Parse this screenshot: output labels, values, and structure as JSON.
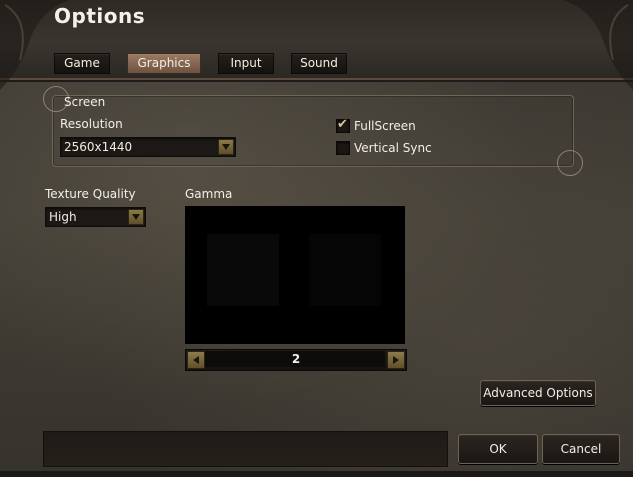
{
  "window": {
    "title": "Options"
  },
  "tabs": [
    {
      "label": "Game",
      "active": false
    },
    {
      "label": "Graphics",
      "active": true
    },
    {
      "label": "Input",
      "active": false
    },
    {
      "label": "Sound",
      "active": false
    }
  ],
  "screen": {
    "group_label": "Screen",
    "resolution_label": "Resolution",
    "resolution_value": "2560x1440",
    "fullscreen": {
      "label": "FullScreen",
      "checked": true
    },
    "vertical_sync": {
      "label": "Vertical Sync",
      "checked": false
    }
  },
  "texture_quality": {
    "label": "Texture Quality",
    "value": "High"
  },
  "gamma": {
    "label": "Gamma",
    "value": "2"
  },
  "buttons": {
    "advanced_options": "Advanced Options",
    "ok": "OK",
    "cancel": "Cancel"
  },
  "colors": {
    "active_tab": "#9c7a62",
    "arrow_button": "#8c7a48",
    "check_mark": "#d9c79a",
    "panel_background": "#3b3832"
  },
  "icons": {
    "dropdown_arrow": "triangle-down-icon",
    "slider_left": "triangle-left-icon",
    "slider_right": "triangle-right-icon",
    "check": "check-icon"
  }
}
